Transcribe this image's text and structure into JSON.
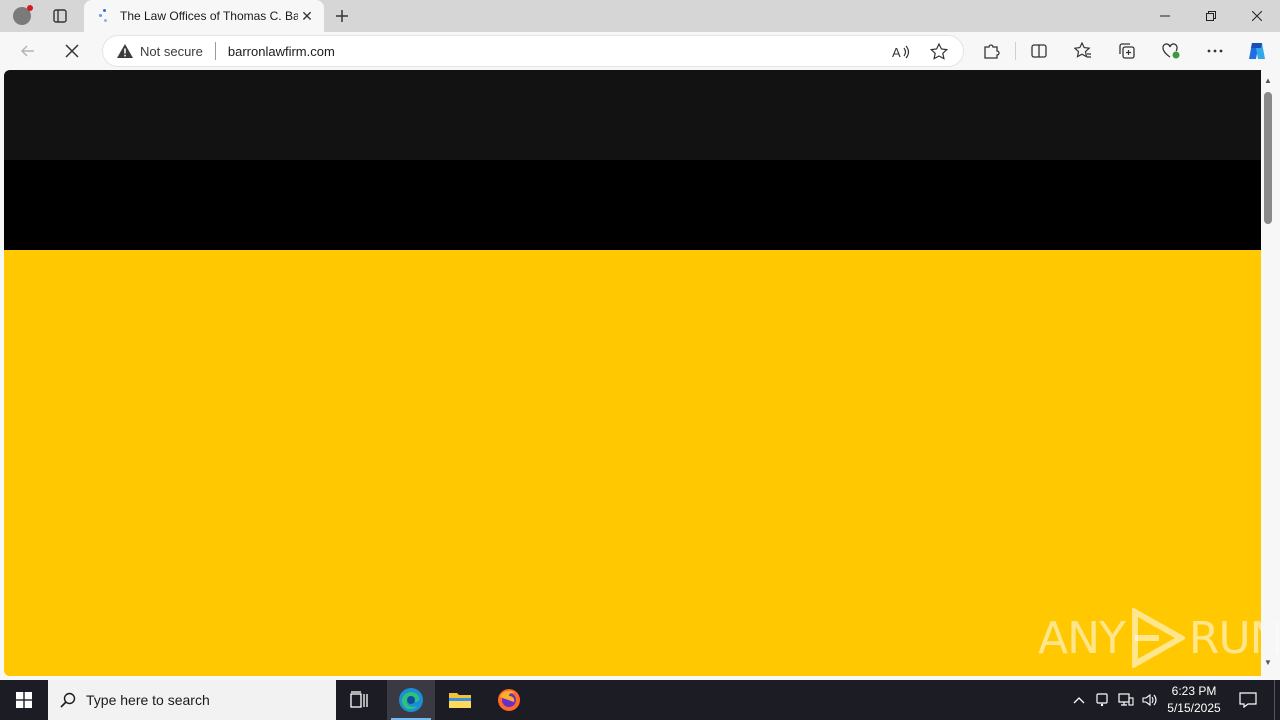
{
  "browser": {
    "tab": {
      "title": "The Law Offices of Thomas C. Ba"
    },
    "address": {
      "security_label": "Not secure",
      "url": "barronlawfirm.com"
    }
  },
  "page": {
    "watermark": {
      "left": "ANY",
      "right": "RUN"
    }
  },
  "taskbar": {
    "search_placeholder": "Type here to search",
    "clock": {
      "time": "6:23 PM",
      "date": "5/15/2025"
    }
  },
  "colors": {
    "page_yellow": "#ffc800",
    "page_dark": "#121212",
    "page_black": "#000000",
    "taskbar": "#1c1c24"
  }
}
